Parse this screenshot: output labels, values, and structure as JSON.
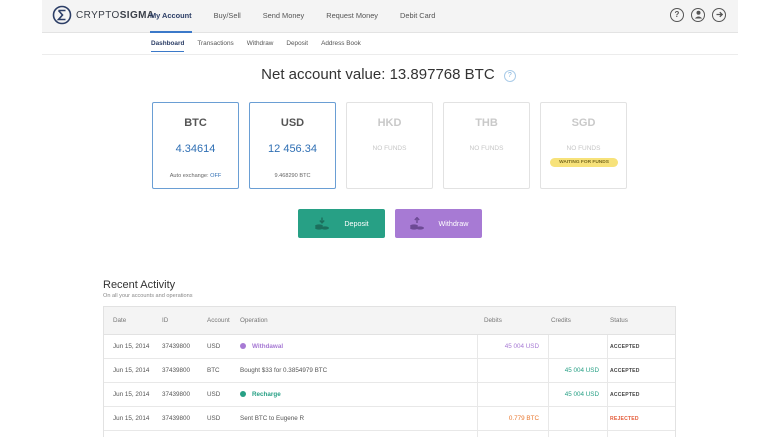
{
  "header": {
    "logo": {
      "brand_light": "CRYPTO",
      "brand_bold": "SIGMA",
      "icon": "sigma-logo-icon"
    },
    "nav": [
      {
        "label": "My Account",
        "active": true
      },
      {
        "label": "Buy/Sell",
        "active": false
      },
      {
        "label": "Send Money",
        "active": false
      },
      {
        "label": "Request Money",
        "active": false
      },
      {
        "label": "Debit Card",
        "active": false
      }
    ],
    "icons": [
      "help-icon",
      "user-icon",
      "logout-icon"
    ]
  },
  "subnav": [
    {
      "label": "Dashboard",
      "active": true
    },
    {
      "label": "Transactions",
      "active": false
    },
    {
      "label": "Withdraw",
      "active": false
    },
    {
      "label": "Deposit",
      "active": false
    },
    {
      "label": "Address Book",
      "active": false
    }
  ],
  "net_value": {
    "text": "Net account value: 13.897768 BTC",
    "help": "?"
  },
  "balances": [
    {
      "currency": "BTC",
      "amount": "4.34614",
      "sub_label": "Auto exchange:",
      "sub_value": "OFF",
      "active": true
    },
    {
      "currency": "USD",
      "amount": "12 456.34",
      "sub_label": "9.468290 BTC",
      "active": true
    },
    {
      "currency": "HKD",
      "no_funds": "NO FUNDS"
    },
    {
      "currency": "THB",
      "no_funds": "NO FUNDS"
    },
    {
      "currency": "SGD",
      "no_funds": "NO FUNDS",
      "badge": "WAITING FOR FUNDS"
    }
  ],
  "actions": {
    "deposit": "Deposit",
    "withdraw": "Withdraw"
  },
  "activity": {
    "title": "Recent Activity",
    "subtitle": "On all your accounts and operations",
    "columns": {
      "date": "Date",
      "id": "ID",
      "account": "Account",
      "operation": "Operation",
      "debits": "Debits",
      "credits": "Credits",
      "status": "Status"
    },
    "rows": [
      {
        "date": "Jun 15, 2014",
        "id": "37439800",
        "account": "USD",
        "operation": "Withdawal",
        "dot": "#a77ad4",
        "bold": true,
        "debit": "45 004 USD",
        "debit_color": "#a77ad4",
        "credit": "",
        "status": "ACCEPTED"
      },
      {
        "date": "Jun 15, 2014",
        "id": "37439800",
        "account": "BTC",
        "operation": "Bought $33 for 0.3854979 BTC",
        "debit": "",
        "credit": "45 004 USD",
        "credit_color": "#27a085",
        "status": "ACCEPTED"
      },
      {
        "date": "Jun 15, 2014",
        "id": "37439800",
        "account": "USD",
        "operation": "Recharge",
        "dot": "#27a085",
        "bold": true,
        "debit": "",
        "credit": "45 004 USD",
        "credit_color": "#27a085",
        "status": "ACCEPTED"
      },
      {
        "date": "Jun 15, 2014",
        "id": "37439800",
        "account": "USD",
        "operation": "Sent  BTC to Eugene R",
        "debit": "0.779 BTC",
        "debit_color": "#e8772e",
        "credit": "",
        "status": "REJECTED"
      },
      {
        "date": "",
        "id": "",
        "account": "",
        "operation": "",
        "debit": "",
        "credit": "",
        "status": ""
      }
    ]
  }
}
